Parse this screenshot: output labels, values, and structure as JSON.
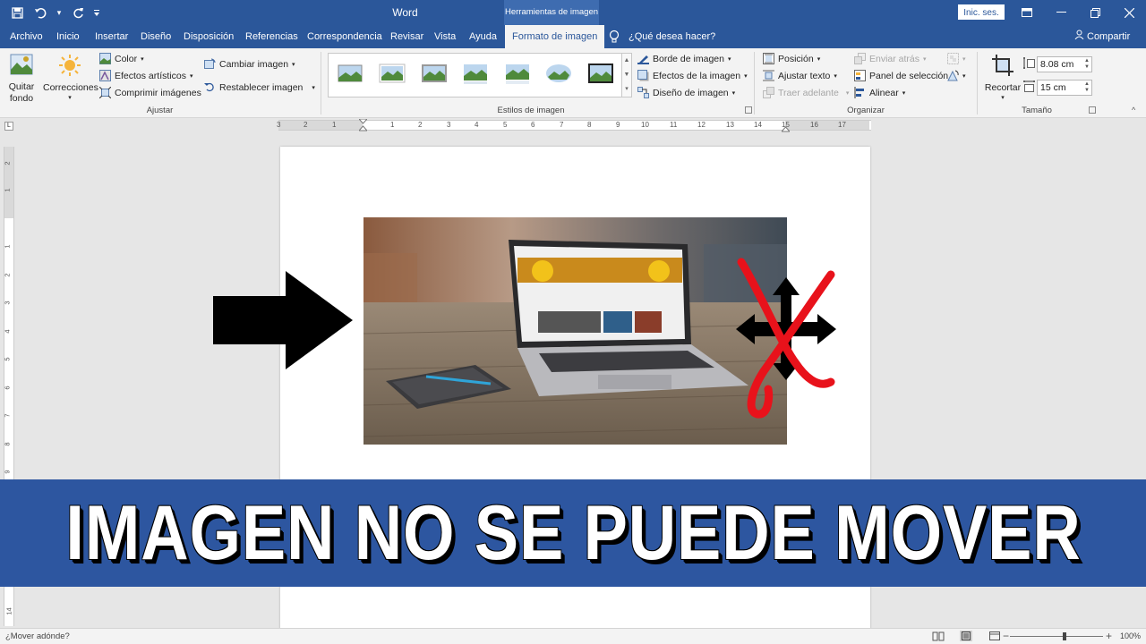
{
  "app": {
    "title": "Word",
    "context_tools": "Herramientas de imagen",
    "login": "Inic. ses.",
    "share": "Compartir",
    "tell_me": "¿Qué desea hacer?"
  },
  "tabs": [
    "Archivo",
    "Inicio",
    "Insertar",
    "Diseño",
    "Disposición",
    "Referencias",
    "Correspondencia",
    "Revisar",
    "Vista",
    "Ayuda",
    "Formato de imagen"
  ],
  "active_tab": "Formato de imagen",
  "ribbon": {
    "quitar_fondo": [
      "Quitar",
      "fondo"
    ],
    "correcciones": "Correcciones",
    "color": "Color",
    "efectos_artisticos": "Efectos artísticos",
    "comprimir": "Comprimir imágenes",
    "cambiar": "Cambiar imagen",
    "restablecer": "Restablecer imagen",
    "group_ajustar": "Ajustar",
    "group_estilos": "Estilos de imagen",
    "borde": "Borde de imagen",
    "efectos_imagen": "Efectos de la imagen",
    "diseno_imagen": "Diseño de imagen",
    "posicion": "Posición",
    "ajustar_texto": "Ajustar texto",
    "traer_adelante": "Traer adelante",
    "enviar_atras": "Enviar atrás",
    "panel_seleccion": "Panel de selección",
    "alinear": "Alinear",
    "group_organizar": "Organizar",
    "recortar": "Recortar",
    "height": "8.08 cm",
    "width": "15 cm",
    "group_tamano": "Tamaño"
  },
  "ruler": {
    "h_numbers": [
      "3",
      "2",
      "1",
      "1",
      "2",
      "3",
      "4",
      "5",
      "6",
      "7",
      "8",
      "9",
      "10",
      "11",
      "12",
      "13",
      "14",
      "15",
      "16",
      "17"
    ],
    "v_numbers": [
      "2",
      "1",
      "1",
      "2",
      "3",
      "4",
      "5",
      "6",
      "7",
      "8",
      "9",
      "14"
    ]
  },
  "banner": {
    "text": "IMAGEN NO SE PUEDE MOVER"
  },
  "status": {
    "message": "¿Mover adónde?",
    "zoom": "100%"
  },
  "colors": {
    "word_blue": "#2b579a",
    "banner_blue": "#2d56a0",
    "cross_red": "#e8121b"
  }
}
